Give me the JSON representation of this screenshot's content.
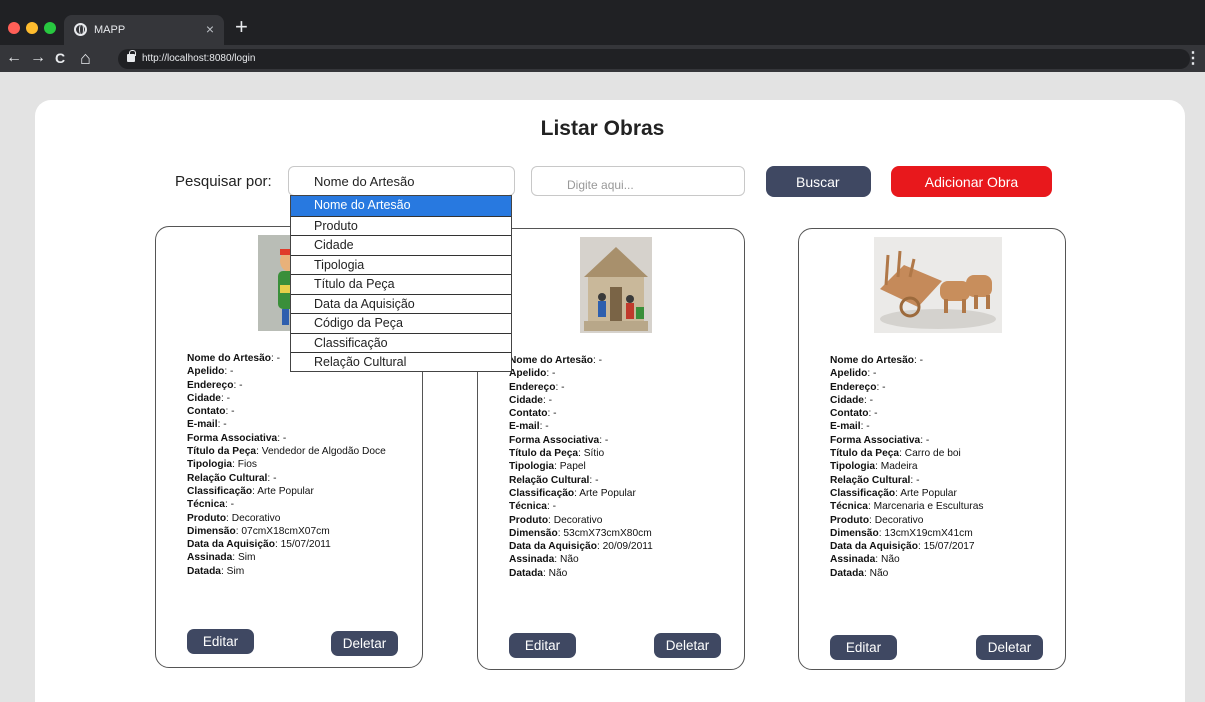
{
  "browser": {
    "tab_title": "MAPP",
    "tab_close": "×",
    "new_tab": "+",
    "url": "http://localhost:8080/login",
    "back": "←",
    "forward": "→",
    "reload": "C",
    "home": "⌂",
    "menu": "⋮"
  },
  "page": {
    "title": "Listar Obras",
    "search_label": "Pesquisar por:",
    "select_value": "Nome do Artesão",
    "input_placeholder": "Digite aqui...",
    "search_button": "Buscar",
    "add_button": "Adicionar Obra"
  },
  "dropdown": {
    "options": [
      "Nome do Artesão",
      "Produto",
      "Cidade",
      "Tipologia",
      "Título da Peça",
      "Data da Aquisição",
      "Código da Peça",
      "Classificação",
      "Relação Cultural"
    ],
    "selected_index": 0
  },
  "cards": [
    {
      "fields": [
        {
          "label": "Nome do Artesão",
          "value": ": -"
        },
        {
          "label": "Apelido",
          "value": ": -"
        },
        {
          "label": "Endereço",
          "value": ": -"
        },
        {
          "label": "Cidade",
          "value": ": -"
        },
        {
          "label": "Contato",
          "value": ": -"
        },
        {
          "label": "E-mail",
          "value": ": -"
        },
        {
          "label": "Forma Associativa",
          "value": ": -"
        },
        {
          "label": "Título da Peça",
          "value": ": Vendedor de Algodão Doce"
        },
        {
          "label": "Tipologia",
          "value": ": Fios"
        },
        {
          "label": "Relação Cultural",
          "value": ": -"
        },
        {
          "label": "Classificação",
          "value": ": Arte Popular"
        },
        {
          "label": "Técnica",
          "value": ": -"
        },
        {
          "label": "Produto",
          "value": ": Decorativo"
        },
        {
          "label": "Dimensão",
          "value": ": 07cmX18cmX07cm"
        },
        {
          "label": "Data da Aquisição",
          "value": ": 15/07/2011"
        },
        {
          "label": "Assinada",
          "value": ": Sim"
        },
        {
          "label": "Datada",
          "value": ": Sim"
        }
      ],
      "edit_label": "Editar",
      "delete_label": "Deletar"
    },
    {
      "fields": [
        {
          "label": "Nome do Artesão",
          "value": ": -"
        },
        {
          "label": "Apelido",
          "value": ": -"
        },
        {
          "label": "Endereço",
          "value": ": -"
        },
        {
          "label": "Cidade",
          "value": ": -"
        },
        {
          "label": "Contato",
          "value": ": -"
        },
        {
          "label": "E-mail",
          "value": ": -"
        },
        {
          "label": "Forma Associativa",
          "value": ": -"
        },
        {
          "label": "Título da Peça",
          "value": ": Sítio"
        },
        {
          "label": "Tipologia",
          "value": ": Papel"
        },
        {
          "label": "Relação Cultural",
          "value": ": -"
        },
        {
          "label": "Classificação",
          "value": ": Arte Popular"
        },
        {
          "label": "Técnica",
          "value": ": -"
        },
        {
          "label": "Produto",
          "value": ": Decorativo"
        },
        {
          "label": "Dimensão",
          "value": ": 53cmX73cmX80cm"
        },
        {
          "label": "Data da Aquisição",
          "value": ": 20/09/2011"
        },
        {
          "label": "Assinada",
          "value": ": Não"
        },
        {
          "label": "Datada",
          "value": ": Não"
        }
      ],
      "edit_label": "Editar",
      "delete_label": "Deletar"
    },
    {
      "fields": [
        {
          "label": "Nome do Artesão",
          "value": ": -"
        },
        {
          "label": "Apelido",
          "value": ": -"
        },
        {
          "label": "Endereço",
          "value": ": -"
        },
        {
          "label": "Cidade",
          "value": ": -"
        },
        {
          "label": "Contato",
          "value": ": -"
        },
        {
          "label": "E-mail",
          "value": ": -"
        },
        {
          "label": "Forma Associativa",
          "value": ": -"
        },
        {
          "label": "Título da Peça",
          "value": ": Carro de boi"
        },
        {
          "label": "Tipologia",
          "value": ": Madeira"
        },
        {
          "label": "Relação Cultural",
          "value": ": -"
        },
        {
          "label": "Classificação",
          "value": ": Arte Popular"
        },
        {
          "label": "Técnica",
          "value": ": Marcenaria e Esculturas"
        },
        {
          "label": "Produto",
          "value": ": Decorativo"
        },
        {
          "label": "Dimensão",
          "value": ": 13cmX19cmX41cm"
        },
        {
          "label": "Data da Aquisição",
          "value": ": 15/07/2017"
        },
        {
          "label": "Assinada",
          "value": ": Não"
        },
        {
          "label": "Datada",
          "value": ": Não"
        }
      ],
      "edit_label": "Editar",
      "delete_label": "Deletar"
    }
  ]
}
